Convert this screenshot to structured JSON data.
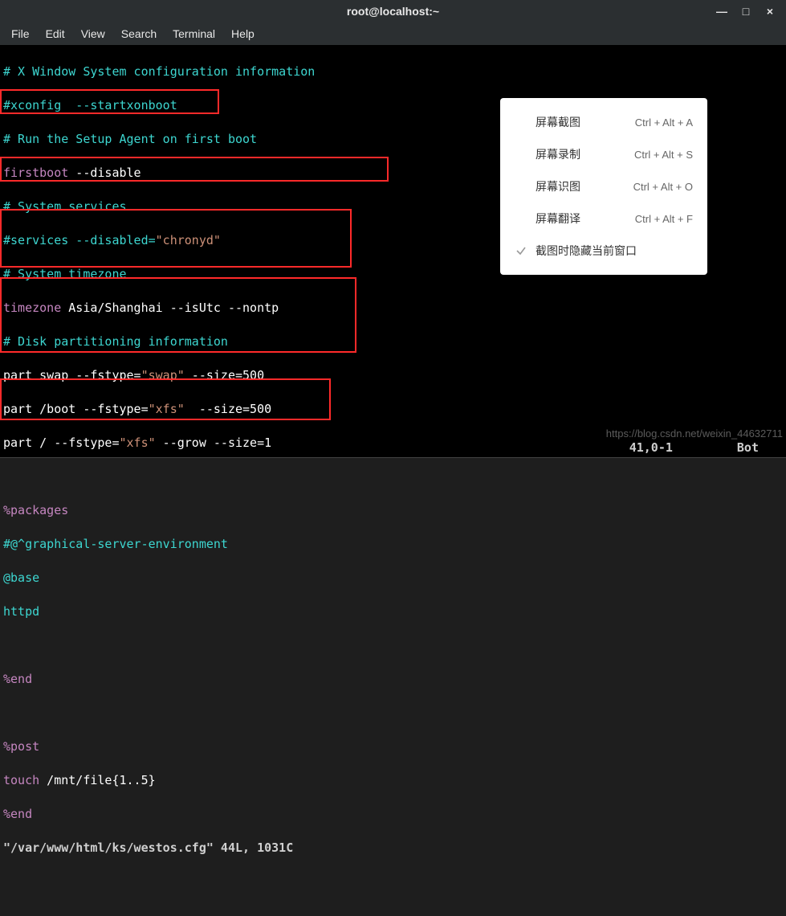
{
  "window": {
    "title": "root@localhost:~",
    "controls": {
      "min": "—",
      "max": "□",
      "close": "×"
    }
  },
  "menu": {
    "file": "File",
    "edit": "Edit",
    "view": "View",
    "search": "Search",
    "terminal": "Terminal",
    "help": "Help"
  },
  "lines": {
    "l1": "# X Window System configuration information",
    "l2": "#xconfig  --startxonboot",
    "l3": "# Run the Setup Agent on first boot",
    "l4_cmd": "firstboot",
    "l4_arg": " --disable",
    "l5": "# System services",
    "l6a": "#services --disabled=",
    "l6b": "\"chronyd\"",
    "l7": "# System timezone",
    "l8_cmd": "timezone",
    "l8_arg": " Asia/Shanghai --isUtc --nontp",
    "l9": "# Disk partitioning information",
    "l10a": "part swap --fstype=",
    "l10b": "\"swap\"",
    "l10c": " --size=500",
    "l11a": "part /boot --fstype=",
    "l11b": "\"xfs\"",
    "l11c": "  --size=500",
    "l12a": "part / --fstype=",
    "l12b": "\"xfs\"",
    "l12c": " --grow --size=1",
    "l13": "",
    "l14": "%packages",
    "l15": "#@^graphical-server-environment",
    "l16": "@base",
    "l17": "httpd",
    "l18": "",
    "l19": "%end",
    "l20": "",
    "l21": "%post",
    "l22a": "touch",
    "l22b": " /mnt/file{1..5}",
    "l23": "%end",
    "status_file": "\"/var/www/html/ks/westos.cfg\"",
    "status_info": " 44L, 1031C",
    "status_pos": "41,0-1",
    "status_loc": "Bot"
  },
  "ctx": {
    "items": [
      {
        "label": "屏幕截图",
        "shortcut": "Ctrl + Alt + A",
        "checked": false
      },
      {
        "label": "屏幕录制",
        "shortcut": "Ctrl + Alt + S",
        "checked": false
      },
      {
        "label": "屏幕识图",
        "shortcut": "Ctrl + Alt + O",
        "checked": false
      },
      {
        "label": "屏幕翻译",
        "shortcut": "Ctrl + Alt + F",
        "checked": false
      },
      {
        "label": "截图时隐藏当前窗口",
        "shortcut": "",
        "checked": true
      }
    ]
  },
  "watermark": "https://blog.csdn.net/weixin_44632711"
}
